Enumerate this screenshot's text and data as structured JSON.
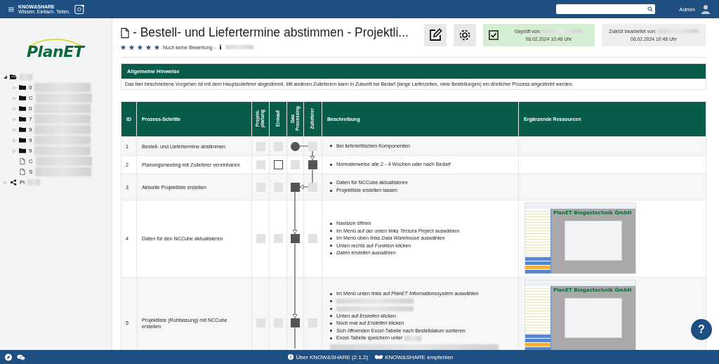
{
  "topbar": {
    "app_name": "KNOW&SHARE",
    "tagline": "Wissen. Einfach. Teilen.",
    "user": "Admin"
  },
  "sidebar": {
    "logo": "PlanET",
    "tree": [
      {
        "kind": "folder",
        "expanded": true,
        "children": [
          {
            "kind": "folder",
            "label": "0",
            "expanded": false
          },
          {
            "kind": "folder",
            "label": "C",
            "expanded": false
          },
          {
            "kind": "folder",
            "label": "0",
            "expanded": false
          },
          {
            "kind": "folder",
            "label": "7",
            "expanded": false
          },
          {
            "kind": "folder",
            "label": "9",
            "expanded": false
          },
          {
            "kind": "folder",
            "label": "9",
            "expanded": false
          },
          {
            "kind": "folder",
            "label": "9",
            "expanded": false
          },
          {
            "kind": "file",
            "label": "C"
          },
          {
            "kind": "file",
            "label": "S"
          }
        ]
      },
      {
        "kind": "share",
        "label": "Pl",
        "expanded": false
      }
    ]
  },
  "header": {
    "title": "- Bestell- und Liefertermine abstimmen - Projektli...",
    "rating": {
      "stars": 5,
      "text": "Noch keine Bewertung -"
    },
    "review": {
      "label": "Geprüft von:",
      "date": "06.02.2024 10:48 Uhr",
      "checked": true
    },
    "edited": {
      "label": "Zuletzt bearbeitet von:",
      "date": "06.02.2024 10:48 Uhr"
    }
  },
  "notice": {
    "title": "Allgemeine Hinweise",
    "text": "Das hier beschriebene Vorgehen ist mit dem Hauptzulieferer abgestimmt. Mit anderen Zulieferern kann in Zukunft bei Bedarf (lange Lieferzeiten, viele Bestellungen) ein ähnlicher Prozess angestrebt werden."
  },
  "table": {
    "columns": [
      {
        "label": "ID",
        "kind": "plain"
      },
      {
        "label": "Prozess-Schritte",
        "kind": "plain"
      },
      {
        "label": "Projekt-\nplanung",
        "kind": "role"
      },
      {
        "label": "Einkauf",
        "kind": "role"
      },
      {
        "label": "Gas\nProcessing",
        "kind": "role"
      },
      {
        "label": "Zulieferer",
        "kind": "role"
      },
      {
        "label": "Beschreibung",
        "kind": "plain"
      },
      {
        "label": "Ergänzende Ressourcen",
        "kind": "plain"
      }
    ],
    "rows": [
      {
        "id": "1",
        "step": "Bestell- und Liefertermine abstimmen",
        "roles": [
          {
            "kind": "empty"
          },
          {
            "kind": "empty"
          },
          {
            "kind": "start"
          },
          {
            "kind": "empty"
          }
        ],
        "description": [
          {
            "text": "Bei lieferkritischen Komponenten"
          }
        ]
      },
      {
        "id": "2",
        "step": "Planungsmeeting mit Zulieferer vereinbaren",
        "roles": [
          {
            "kind": "empty"
          },
          {
            "kind": "outline"
          },
          {
            "kind": "empty"
          },
          {
            "kind": "task"
          }
        ],
        "description": [
          {
            "text": "Normalerweise alle 2 - 4 Wochen oder nach Bedarf"
          }
        ]
      },
      {
        "id": "3",
        "step": "Aktuelle Projektliste erstellen",
        "roles": [
          {
            "kind": "empty"
          },
          {
            "kind": "empty"
          },
          {
            "kind": "task"
          },
          {
            "kind": "empty"
          }
        ],
        "description": [
          {
            "text": "Daten für NCCube aktualisieren"
          },
          {
            "text": "Projektliste erstellen lassen"
          }
        ]
      },
      {
        "id": "4",
        "step": "Daten für den NCCube aktualisieren",
        "roles": [
          {
            "kind": "empty"
          },
          {
            "kind": "empty"
          },
          {
            "kind": "task"
          },
          {
            "kind": "empty"
          }
        ],
        "description": [
          {
            "text": "Navision öffnen"
          },
          {
            "text": "Im Menü auf der unten links *Tectura Project* auswählen"
          },
          {
            "text": "Im Menü oben links *Data Warehouse* auswählen"
          },
          {
            "text": "Unten rechts auf *Funktion* klicken"
          },
          {
            "text": "*Daten erstellen* auswählen"
          }
        ],
        "resource": {
          "kind": "screenshot",
          "heading": "PlanET Biogastechnik GmbH"
        }
      },
      {
        "id": "5",
        "step": "Projektliste (Rohfassung) mit NCCube erstellen",
        "roles": [
          {
            "kind": "empty"
          },
          {
            "kind": "empty"
          },
          {
            "kind": "task"
          },
          {
            "kind": "empty"
          }
        ],
        "description": [
          {
            "text": "Im Menü unten links auf *PlanET Informationssystem* auswählen"
          },
          {
            "kind": "redacted"
          },
          {
            "kind": "redacted"
          },
          {
            "text": "Unten auf *Erstellen* klicken"
          },
          {
            "text": "Noch mal auf *Erstellen* klicken"
          },
          {
            "text": "Sich öffnenden Excel-Tabelle nach Bestelldatum sortieren"
          },
          {
            "text": "Excel-Tabelle speichern unter",
            "redacted_tail": true
          }
        ],
        "resource": {
          "kind": "screenshot",
          "heading": "PlanET Biogastechnik GmbH"
        }
      }
    ]
  },
  "footer": {
    "about": "Über KNOW&SHARE (2.1.2)",
    "recommend": "KNOW&SHARE empfehlen",
    "help": "?"
  }
}
